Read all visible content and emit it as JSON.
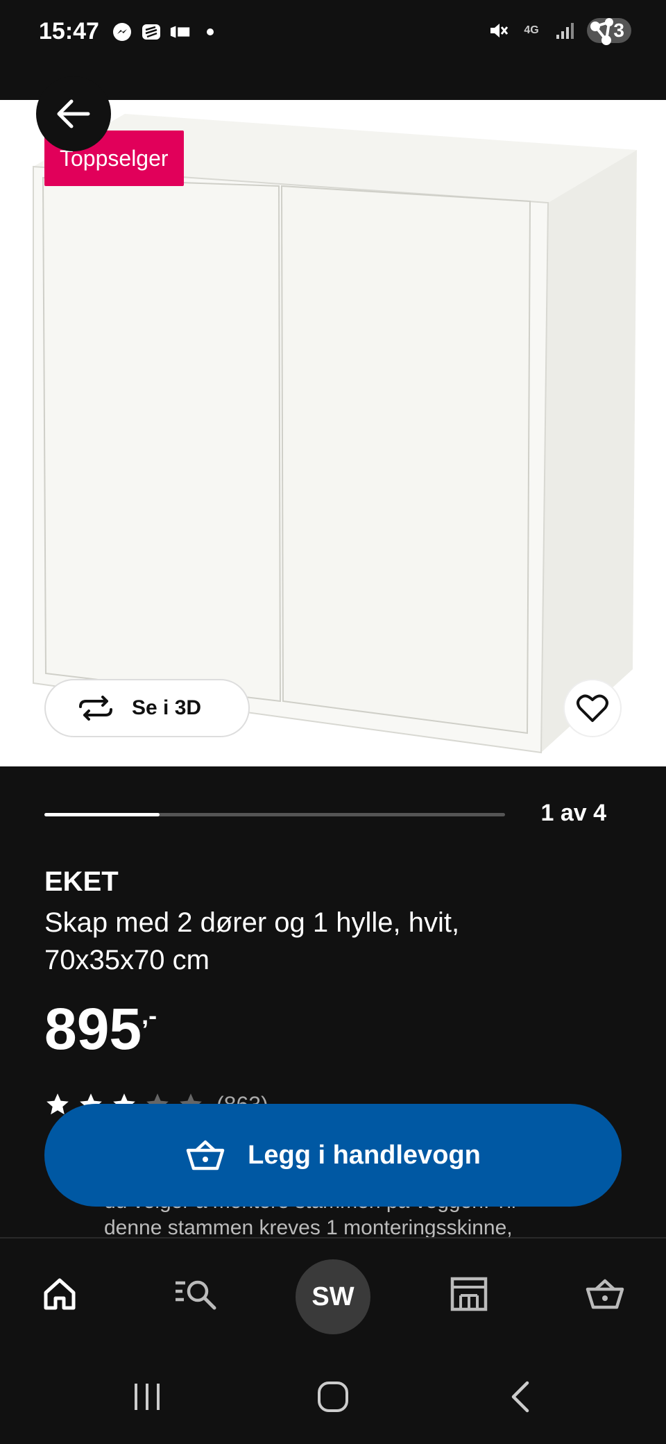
{
  "status_bar": {
    "time": "15:47",
    "network": "4G",
    "notification_badge": "3"
  },
  "product": {
    "badge": "Toppselger",
    "see_3d_label": "Se i 3D",
    "carousel": {
      "label": "1 av 4",
      "current": 1,
      "total": 4
    },
    "name": "EKET",
    "description": "Skap med 2 dører og 1 hylle, hvit, 70x35x70 cm",
    "price": "895",
    "price_suffix": ",-",
    "rating": {
      "stars": 3,
      "max": 5,
      "count": "(863)"
    },
    "details_fragment_1": "du velger å montere stammen på veggen. Til",
    "details_fragment_2": "denne stammen kreves 1 monteringsskinne,"
  },
  "actions": {
    "add_to_cart": "Legg i handlevogn"
  },
  "bottom_nav": {
    "avatar_initials": "SW",
    "items": [
      "home-icon",
      "search-icon",
      "avatar",
      "store-icon",
      "cart-icon"
    ]
  },
  "colors": {
    "background": "#111111",
    "accent_blue": "#0058a3",
    "badge_pink": "#e1005a"
  }
}
